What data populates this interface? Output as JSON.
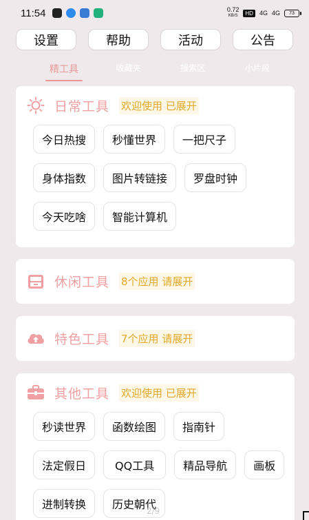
{
  "status_bar": {
    "time": "11:54",
    "speed_value": "0.72",
    "speed_unit": "KB/S",
    "hd": "HD",
    "signal1": "4G",
    "signal2": "4G",
    "battery": "73"
  },
  "top_buttons": [
    "设置",
    "帮助",
    "活动",
    "公告"
  ],
  "tabs": [
    "精工具",
    "收藏夹",
    "搜索区",
    "小片段"
  ],
  "cards": [
    {
      "title": "日常工具",
      "note": "欢迎使用 已展开",
      "icon": "sun-icon",
      "rows": [
        [
          "今日热搜",
          "秒懂世界",
          "一把尺子"
        ],
        [
          "身体指数",
          "图片转链接",
          "罗盘时钟"
        ],
        [
          "今天吃啥",
          "智能计算机"
        ]
      ]
    },
    {
      "title": "休闲工具",
      "note": "8个应用 请展开",
      "icon": "inbox-icon"
    },
    {
      "title": "特色工具",
      "note": "7个应用 请展开",
      "icon": "cloud-upload-icon"
    },
    {
      "title": "其他工具",
      "note": "欢迎使用 已展开",
      "icon": "toolbox-icon",
      "rows": [
        [
          "秒读世界",
          "函数绘图",
          "指南针"
        ],
        [
          "法定假日",
          "QQ工具",
          "精品导航"
        ],
        [
          "画板",
          "进制转换",
          "历史朝代"
        ]
      ]
    }
  ],
  "page_indicator": "2/9",
  "colors": {
    "background": "#efe9ec",
    "title_pink": "#f0a0a2",
    "note_gold": "#e2a826",
    "tab_active": "#e99a96"
  }
}
